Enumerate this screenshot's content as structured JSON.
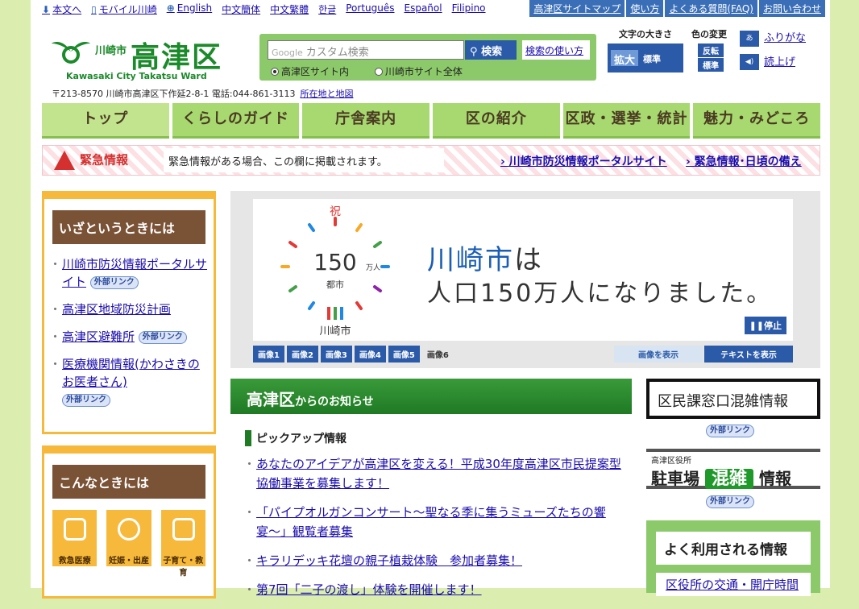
{
  "topbar": {
    "links": [
      "本文へ",
      "モバイル川崎",
      "English",
      "中文簡体",
      "中文繁體",
      "한글",
      "Português",
      "Español",
      "Filipino"
    ],
    "utils": [
      "高津区サイトマップ",
      "使い方",
      "よくある質問(FAQ)",
      "お問い合わせ"
    ]
  },
  "header": {
    "city": "川崎市",
    "ward": "高津区",
    "english": "Kawasaki City Takatsu Ward",
    "address": "〒213-8570 川崎市高津区下作延2-8-1 電話:044-861-3113",
    "map_link": "所在地と地図"
  },
  "search": {
    "google": "Google",
    "placeholder": "カスタム検索",
    "button": "検索",
    "help": "検索の使い方",
    "radio_ward": "高津区サイト内",
    "radio_city": "川崎市サイト全体"
  },
  "textsize": {
    "label": "文字の大きさ",
    "large": "拡大",
    "standard": "標準"
  },
  "colorchange": {
    "label": "色の変更",
    "invert": "反転",
    "standard": "標準"
  },
  "access": {
    "furigana": "ふりがな",
    "readout": "読上げ",
    "furigana_icon": "ふりがな-icon",
    "speaker_icon": "speaker-icon"
  },
  "nav": [
    "トップ",
    "くらしのガイド",
    "庁舎案内",
    "区の紹介",
    "区政・選挙・統計",
    "魅力・みどころ"
  ],
  "emergency": {
    "title": "緊急情報",
    "message": "緊急情報がある場合、この欄に掲載されます。",
    "link1": "川崎市防災情報ポータルサイト",
    "link2": "緊急情報･日頃の備え"
  },
  "left": {
    "emergency_title": "いざというときには",
    "emergency_items": [
      {
        "text": "川崎市防災情報ポータルサイト",
        "ext": "外部リンク"
      },
      {
        "text": "高津区地域防災計画",
        "ext": ""
      },
      {
        "text": "高津区避難所",
        "ext": "外部リンク"
      },
      {
        "text": "医療機関情報(かわさきのお医者さん)",
        "ext": "外部リンク"
      }
    ],
    "when_title": "こんなときには",
    "tiles": [
      "救急医療",
      "妊娠・出産",
      "子育て・教育"
    ]
  },
  "slider": {
    "logo_celebrate": "祝",
    "logo_150": "150",
    "logo_man": "万人",
    "logo_toshi": "都市",
    "logo_city": "川崎市",
    "headline_city": "川崎市",
    "headline_ha": "は",
    "headline2": "人口150万人になりました。",
    "stop": "停止",
    "tabs": [
      "画像1",
      "画像2",
      "画像3",
      "画像4",
      "画像5",
      "画像6"
    ],
    "show_image": "画像を表示",
    "show_text": "テキストを表示"
  },
  "news": {
    "title_main": "高津区",
    "title_sub": "からのお知らせ",
    "pickup": "ピックアップ情報",
    "items": [
      "あなたのアイデアが高津区を変える！平成30年度高津区市民提案型協働事業を募集します！",
      "「パイプオルガンコンサート〜聖なる季に集うミューズたちの饗宴〜」観覧者募集",
      "キラリデッキ花壇の親子植栽体験　参加者募集！",
      "第7回「二子の渡し」体験を開催します！"
    ]
  },
  "right": {
    "crowd": "区民課窓口混雑情報",
    "ext": "外部リンク",
    "parking_small": "高津区役所",
    "parking_a": "駐車場",
    "parking_b": "混雑",
    "parking_c": "情報",
    "freq_title": "よく利用される情報",
    "freq_item": "区役所の交通・開庁時間"
  },
  "colors": {
    "green": "#1b8a2a",
    "nav": "#a8d870",
    "orange": "#f6b93b",
    "blue": "#2a5aa8",
    "brown": "#7a5236"
  }
}
